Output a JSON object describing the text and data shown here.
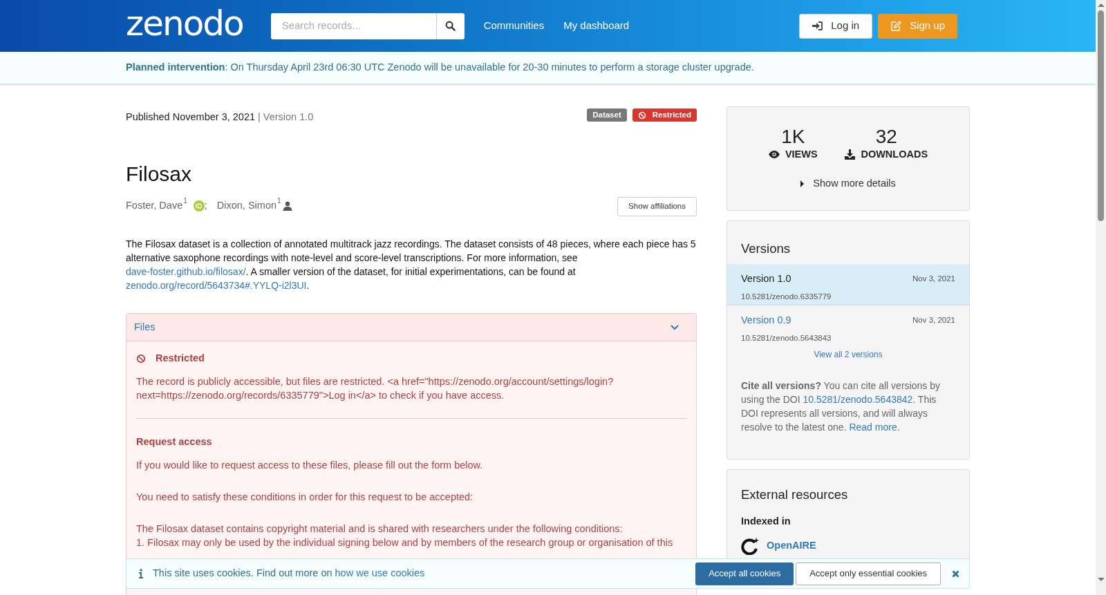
{
  "header": {
    "logo": "zenodo",
    "search": {
      "placeholder": "Search records..."
    },
    "nav": [
      "Communities",
      "My dashboard"
    ],
    "buttons": [
      {
        "kind": "login",
        "label": "Log in"
      },
      {
        "kind": "signup",
        "label": "Sign up"
      }
    ]
  },
  "announcement": {
    "title": "Planned intervention",
    "text": ": On Thursday April 23rd 06:30 UTC Zenodo will be unavailable for 20-30 minutes to perform a storage cluster upgrade."
  },
  "record": {
    "published": "Published November 3, 2021",
    "separator": "|",
    "version": "Version 1.0",
    "badges": [
      {
        "kind": "type",
        "label": "Dataset"
      },
      {
        "kind": "access",
        "label": "Restricted"
      }
    ],
    "title": "Filosax",
    "creators": [
      {
        "name": "Foster, Dave",
        "affiliation": "1",
        "kind": "orcid",
        "separator": ";"
      },
      {
        "name": "Dixon, Simon",
        "affiliation": "1",
        "kind": "person"
      }
    ],
    "affiliations_button": "Show affiliations",
    "description": [
      {
        "kind": "text",
        "text": "The Filosax dataset is a collection of annotated multitrack jazz recordings. The dataset consists of 48 pieces, where each piece has 5 alternative saxophone recordings with note-level and score-level transcriptions. For more information, see "
      },
      {
        "kind": "link",
        "text": "dave-foster.github.io/filosax/"
      },
      {
        "kind": "text",
        "text": ". A smaller version of the dataset, for initial experimentations, can be found at "
      },
      {
        "kind": "link",
        "text": "zenodo.org/record/5643734#.YYLQ-i2l3UI"
      },
      {
        "kind": "text",
        "text": "."
      }
    ],
    "files": {
      "title": "Files",
      "expanded": true,
      "restricted_title": "Restricted",
      "restricted_text": "The record is publicly accessible, but files are restricted. <a href=\"https://zenodo.org/account/settings/login?next=https://zenodo.org/records/6335779\">Log in</a> to check if you have access.",
      "request_title": "Request access",
      "paragraphs": [
        "If you would like to request access to these files, please fill out the form below.",
        "You need to satisfy these conditions in order for this request to be accepted:"
      ],
      "conditions": [
        "The Filosax dataset contains copyright material and is shared with researchers under the following conditions:",
        "1. Filosax may only be used by the individual signing below and by members of the research group or organisation of this"
      ]
    }
  },
  "sidebar": {
    "stats": [
      {
        "kind": "views",
        "value": "1K",
        "label": "VIEWS"
      },
      {
        "kind": "downloads",
        "value": "32",
        "label": "DOWNLOADS"
      }
    ],
    "more_details": "Show more details",
    "versions": {
      "title": "Versions",
      "items": [
        {
          "label": "Version 1.0",
          "date": "Nov 3, 2021",
          "doi": "10.5281/zenodo.6335779",
          "selected": true
        },
        {
          "label": "Version 0.9",
          "date": "Nov 3, 2021",
          "doi": "10.5281/zenodo.5643843",
          "selected": false
        }
      ],
      "view_all": "View all 2 versions",
      "cite": [
        {
          "kind": "bold",
          "text": "Cite all versions?"
        },
        {
          "kind": "text",
          "text": " You can cite all versions by using the DOI "
        },
        {
          "kind": "link",
          "text": "10.5281/zenodo.5643842"
        },
        {
          "kind": "text",
          "text": ". This DOI represents all versions, and will always resolve to the latest one. "
        },
        {
          "kind": "link",
          "text": "Read more"
        },
        {
          "kind": "text",
          "text": "."
        }
      ]
    },
    "external": {
      "title": "External resources",
      "subtitle": "Indexed in",
      "items": [
        "OpenAIRE"
      ]
    }
  },
  "cookie_banner": {
    "text": "This site uses cookies. Find out more on ",
    "link": "how we use cookies",
    "buttons": [
      {
        "kind": "primary",
        "label": "Accept all cookies"
      },
      {
        "kind": "secondary",
        "label": "Accept only essential cookies"
      }
    ]
  }
}
